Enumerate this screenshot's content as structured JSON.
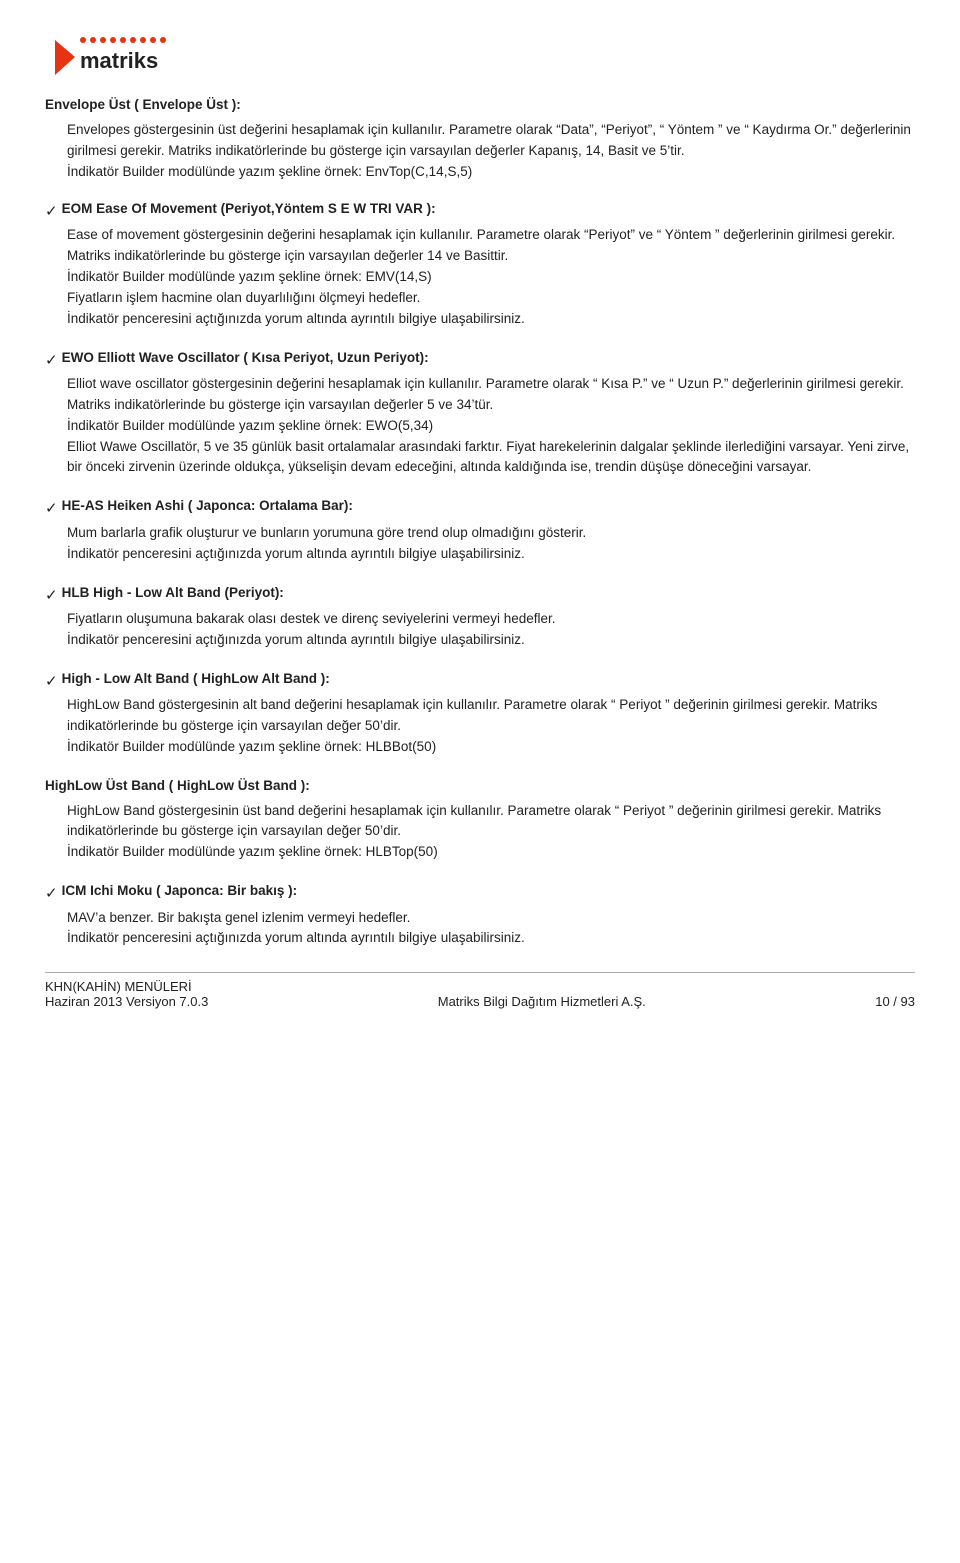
{
  "logo": {
    "alt": "matriks"
  },
  "sections": [
    {
      "id": "envelope-ust",
      "has_check": false,
      "title": "Envelope Üst ( Envelope Üst ):",
      "paragraphs": [
        "Envelopes göstergesinin üst değerini hesaplamak için kullanılır. Parametre olarak “Data”, “Periyot”, “ Yöntem ” ve “ Kaydırma Or.” değerlerinin girilmesi gerekir. Matriks indikatörlerinde bu gösterge için varsayılan değerler Kapanış, 14, Basit ve 5’tir.",
        "İndikatör Builder modülünde yazım şekline örnek: EnvTop(C,14,S,5)"
      ]
    },
    {
      "id": "eom",
      "has_check": true,
      "title": "EOM  Ease Of Movement (Periyot,Yöntem S E W TRI VAR ):",
      "paragraphs": [
        "Ease of movement göstergesinin değerini hesaplamak için kullanılır. Parametre olarak “Periyot” ve “ Yöntem ” değerlerinin girilmesi gerekir. Matriks indikatörlerinde bu gösterge için varsayılan değerler 14 ve Basittir.",
        "İndikatör Builder modülünde yazım şekline örnek: EMV(14,S)",
        "Fiyatların işlem hacmine olan duyarlılığını ölçmeyi hedefler.",
        "İndikatör penceresini açtığınızda yorum altında ayrıntılı bilgiye ulaşabilirsiniz."
      ]
    },
    {
      "id": "ewo",
      "has_check": true,
      "title": "EWO  Elliott Wave Oscillator ( Kısa Periyot, Uzun Periyot):",
      "paragraphs": [
        "Elliot wave oscillator göstergesinin değerini hesaplamak için kullanılır. Parametre olarak “ Kısa P.” ve “ Uzun P.” değerlerinin girilmesi gerekir. Matriks indikatörlerinde bu gösterge için varsayılan değerler 5 ve 34’tür.",
        "İndikatör Builder modülünde yazım şekline örnek: EWO(5,34)",
        "Elliot Wawe Oscillatör, 5 ve 35 günlük basit ortalamalar arasındaki farktır. Fiyat harekelerinin dalgalar şeklinde ilerlediğini varsayar. Yeni zirve, bir önceki zirvenin üzerinde oldukça, yükselişin devam edeceğini, altında kaldığında ise, trendin düşüşe döneceğini varsayar."
      ]
    },
    {
      "id": "he-as",
      "has_check": true,
      "title": "HE-AS  Heiken Ashi ( Japonca: Ortalama Bar):",
      "paragraphs": [
        "Mum barlarla grafik oluşturur ve bunların yorumuna göre trend olup olmadığını gösterir.",
        "İndikatör penceresini açtığınızda yorum altında ayrıntılı bilgiye ulaşabilirsiniz."
      ]
    },
    {
      "id": "hlb",
      "has_check": true,
      "title": "HLB  High - Low Alt Band (Periyot):",
      "paragraphs": [
        "Fiyatların oluşumuna bakarak olası destek ve direnç seviyelerini vermeyi hedefler.",
        "İndikatör penceresini açtığınızda yorum altında ayrıntılı bilgiye ulaşabilirsiniz."
      ]
    },
    {
      "id": "high-low-alt-band",
      "has_check": true,
      "title": "High - Low Alt Band ( HighLow Alt Band ):",
      "paragraphs": [
        "HighLow Band göstergesinin alt band değerini hesaplamak için kullanılır. Parametre olarak “ Periyot ” değerinin girilmesi gerekir. Matriks indikatörlerinde bu gösterge için varsayılan değer 50’dir.",
        "İndikatör Builder modülünde yazım şekline örnek: HLBBot(50)"
      ]
    },
    {
      "id": "highlow-ust",
      "has_check": false,
      "title": "HighLow Üst Band ( HighLow Üst Band ):",
      "paragraphs": [
        "HighLow Band göstergesinin üst band değerini hesaplamak için kullanılır. Parametre olarak “ Periyot ” değerinin girilmesi gerekir. Matriks indikatörlerinde bu gösterge için varsayılan değer 50’dir.",
        "İndikatör Builder modülünde yazım şekline örnek: HLBTop(50)"
      ]
    },
    {
      "id": "icm",
      "has_check": true,
      "title": "ICM  Ichi Moku ( Japonca: Bir bakış ):",
      "paragraphs": [
        "MAV’a benzer. Bir bakışta genel izlenim vermeyi hedefler.",
        "İndikatör penceresini açtığınızda yorum altında ayrıntılı bilgiye ulaşabilirsiniz."
      ]
    }
  ],
  "footer": {
    "left_line1": "KHN(KAHİN) MENÜLERİ",
    "left_line2": "Haziran 2013 Versiyon 7.0.3",
    "center": "Matriks Bilgi Dağıtım Hizmetleri A.Ş.",
    "right": "10 / 93"
  }
}
